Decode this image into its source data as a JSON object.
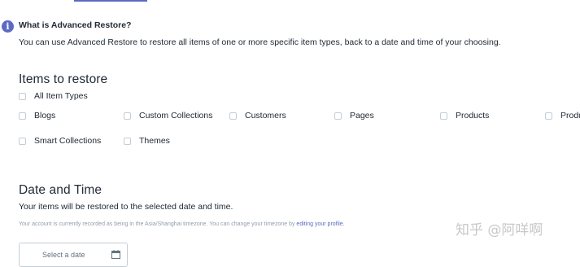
{
  "info": {
    "icon": "info-icon",
    "title": "What is Advanced Restore?",
    "description": "You can use Advanced Restore to restore all items of one or more specific item types, back to a date and time of your choosing."
  },
  "items_section": {
    "heading": "Items to restore",
    "all_label": "All Item Types",
    "types": [
      "Blogs",
      "Custom Collections",
      "Customers",
      "Pages",
      "Products",
      "Products",
      "Smart Collections",
      "Themes"
    ]
  },
  "date_section": {
    "heading": "Date and Time",
    "description": "Your items will be restored to the selected date and time.",
    "timezone_note": "Your account is currently recorded as being in the Asia/Shanghai timezone. You can change your timezone by",
    "timezone_link": "editing your profile.",
    "date_placeholder": "Select a date",
    "calendar_icon": "calendar-icon"
  },
  "watermark": "知乎 @阿咩啊",
  "colors": {
    "accent": "#5c6ac4",
    "text": "#212b36",
    "muted": "#919eab",
    "border": "#c4cdd5"
  }
}
